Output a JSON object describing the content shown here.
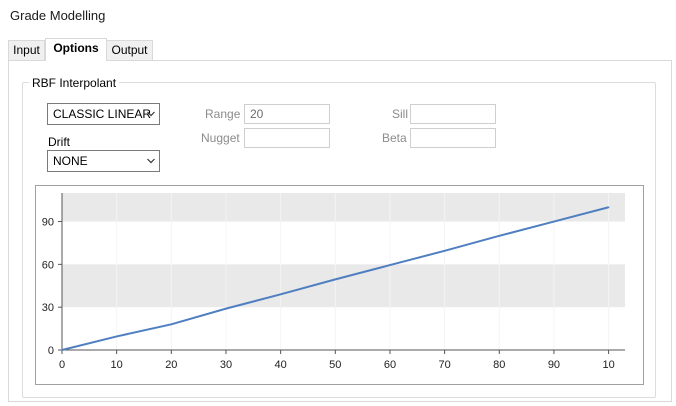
{
  "window": {
    "title": "Grade Modelling"
  },
  "tabs": [
    {
      "label": "Input",
      "active": false
    },
    {
      "label": "Options",
      "active": true
    },
    {
      "label": "Output",
      "active": false
    }
  ],
  "rbf": {
    "group_label": "RBF Interpolant",
    "method_value": "CLASSIC LINEAR",
    "drift_label": "Drift",
    "drift_value": "NONE",
    "range_label": "Range",
    "range_value": "20",
    "nugget_label": "Nugget",
    "nugget_value": "",
    "sill_label": "Sill",
    "sill_value": "",
    "beta_label": "Beta",
    "beta_value": ""
  },
  "icons": {
    "dropdown": "chevron-down-icon"
  },
  "colors": {
    "line": "#4f7fc0",
    "band": "#e9e9e9",
    "axis": "#555555"
  },
  "chart_data": {
    "type": "line",
    "x": [
      0,
      10,
      20,
      30,
      40,
      50,
      60,
      70,
      80,
      90,
      100
    ],
    "y": [
      0,
      9.5,
      18,
      29,
      39,
      49.5,
      59.5,
      69.5,
      80,
      90,
      100
    ],
    "x_ticks": [
      "0",
      "10",
      "20",
      "30",
      "40",
      "50",
      "60",
      "70",
      "80",
      "90",
      "10"
    ],
    "y_ticks": [
      "0",
      "30",
      "60",
      "90"
    ],
    "y_tick_values": [
      0,
      30,
      60,
      90
    ],
    "xlim": [
      0,
      103
    ],
    "ylim": [
      0,
      110
    ],
    "bands": [
      [
        30,
        60
      ],
      [
        90,
        110
      ]
    ],
    "grid": true,
    "legend": "none",
    "title": "",
    "xlabel": "",
    "ylabel": ""
  }
}
